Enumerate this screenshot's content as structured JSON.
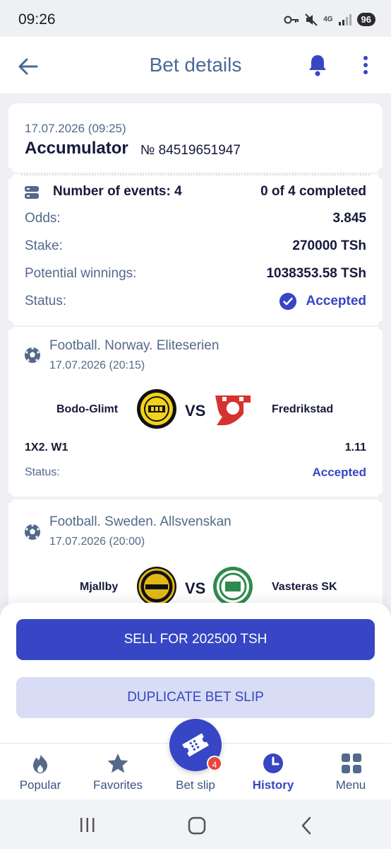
{
  "status_bar": {
    "time": "09:26",
    "network": "4G",
    "battery": "96"
  },
  "header": {
    "title": "Bet details",
    "back_icon": "arrow-left-icon",
    "bell_icon": "bell-icon",
    "more_icon": "more-vertical-icon"
  },
  "summary": {
    "date": "17.07.2026 (09:25)",
    "type": "Accumulator",
    "number": "№ 84519651947"
  },
  "details": {
    "events_label": "Number of events: 4",
    "events_progress": "0 of 4 completed",
    "odds_label": "Odds:",
    "odds_value": "3.845",
    "stake_label": "Stake:",
    "stake_value": "270000 TSh",
    "winnings_label": "Potential winnings:",
    "winnings_value": "1038353.58 TSh",
    "status_label": "Status:",
    "status_value": "Accepted"
  },
  "events": [
    {
      "league": "Football. Norway. Eliteserien",
      "date": "17.07.2026 (20:15)",
      "home": "Bodo-Glimt",
      "away": "Fredrikstad",
      "vs": "VS",
      "market": "1X2. W1",
      "odd": "1.11",
      "status_label": "Status:",
      "status_value": "Accepted"
    },
    {
      "league": "Football. Sweden. Allsvenskan",
      "date": "17.07.2026 (20:00)",
      "home": "Mjallby",
      "away": "Vasteras SK",
      "vs": "VS"
    }
  ],
  "actions": {
    "sell": "SELL FOR 202500 TSH",
    "duplicate": "DUPLICATE BET SLIP"
  },
  "nav": {
    "items": [
      {
        "label": "Popular",
        "icon": "flame-icon"
      },
      {
        "label": "Favorites",
        "icon": "star-icon"
      },
      {
        "label": "Bet slip",
        "icon": "ticket-icon"
      },
      {
        "label": "History",
        "icon": "clock-icon"
      },
      {
        "label": "Menu",
        "icon": "grid-icon"
      }
    ],
    "betslip_badge": "4"
  },
  "colors": {
    "accent": "#3646c4",
    "accent_light": "#d8dcf4",
    "title": "#4a6a96",
    "muted": "#54698b",
    "badge": "#e8473a"
  }
}
